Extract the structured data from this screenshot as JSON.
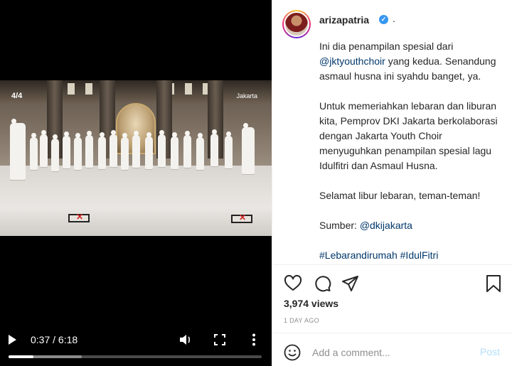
{
  "video": {
    "overlay_logo_left": "4/4",
    "overlay_logo_right": "Jakarta",
    "time_display": "0:37 / 6:18",
    "progress_played": 0.098,
    "progress_buffered": 0.29,
    "controls": {
      "play": "play-icon",
      "volume": "volume-icon",
      "fullscreen": "fullscreen-icon",
      "more": "more-vertical-icon"
    }
  },
  "post": {
    "username": "arizapatria",
    "verified": "✓",
    "dot": ".",
    "caption": {
      "p1_text_a": "Ini dia penampilan spesial dari ",
      "p1_mention": "@jktyouthchoir",
      "p1_text_b": " yang kedua. Senandung asmaul husna ini syahdu banget, ya.",
      "p2": "Untuk memeriahkan lebaran dan liburan kita, Pemprov DKI Jakarta berkolaborasi dengan Jakarta Youth Choir menyuguhkan penampilan spesial lagu Idulfitri dan Asmaul Husna.",
      "p3": "Selamat libur lebaran, teman-teman!",
      "p4_label": "Sumber: ",
      "p4_mention": "@dkijakarta",
      "hashtag1": "#Lebarandirumah",
      "hashtag2": "#IdulFitri"
    },
    "actions": {
      "like": "heart-icon",
      "comment": "comment-icon",
      "share": "share-icon",
      "save": "bookmark-icon"
    },
    "views": "3,974 views",
    "timestamp": "1 DAY AGO",
    "comment_placeholder": "Add a comment...",
    "post_label": "Post"
  }
}
